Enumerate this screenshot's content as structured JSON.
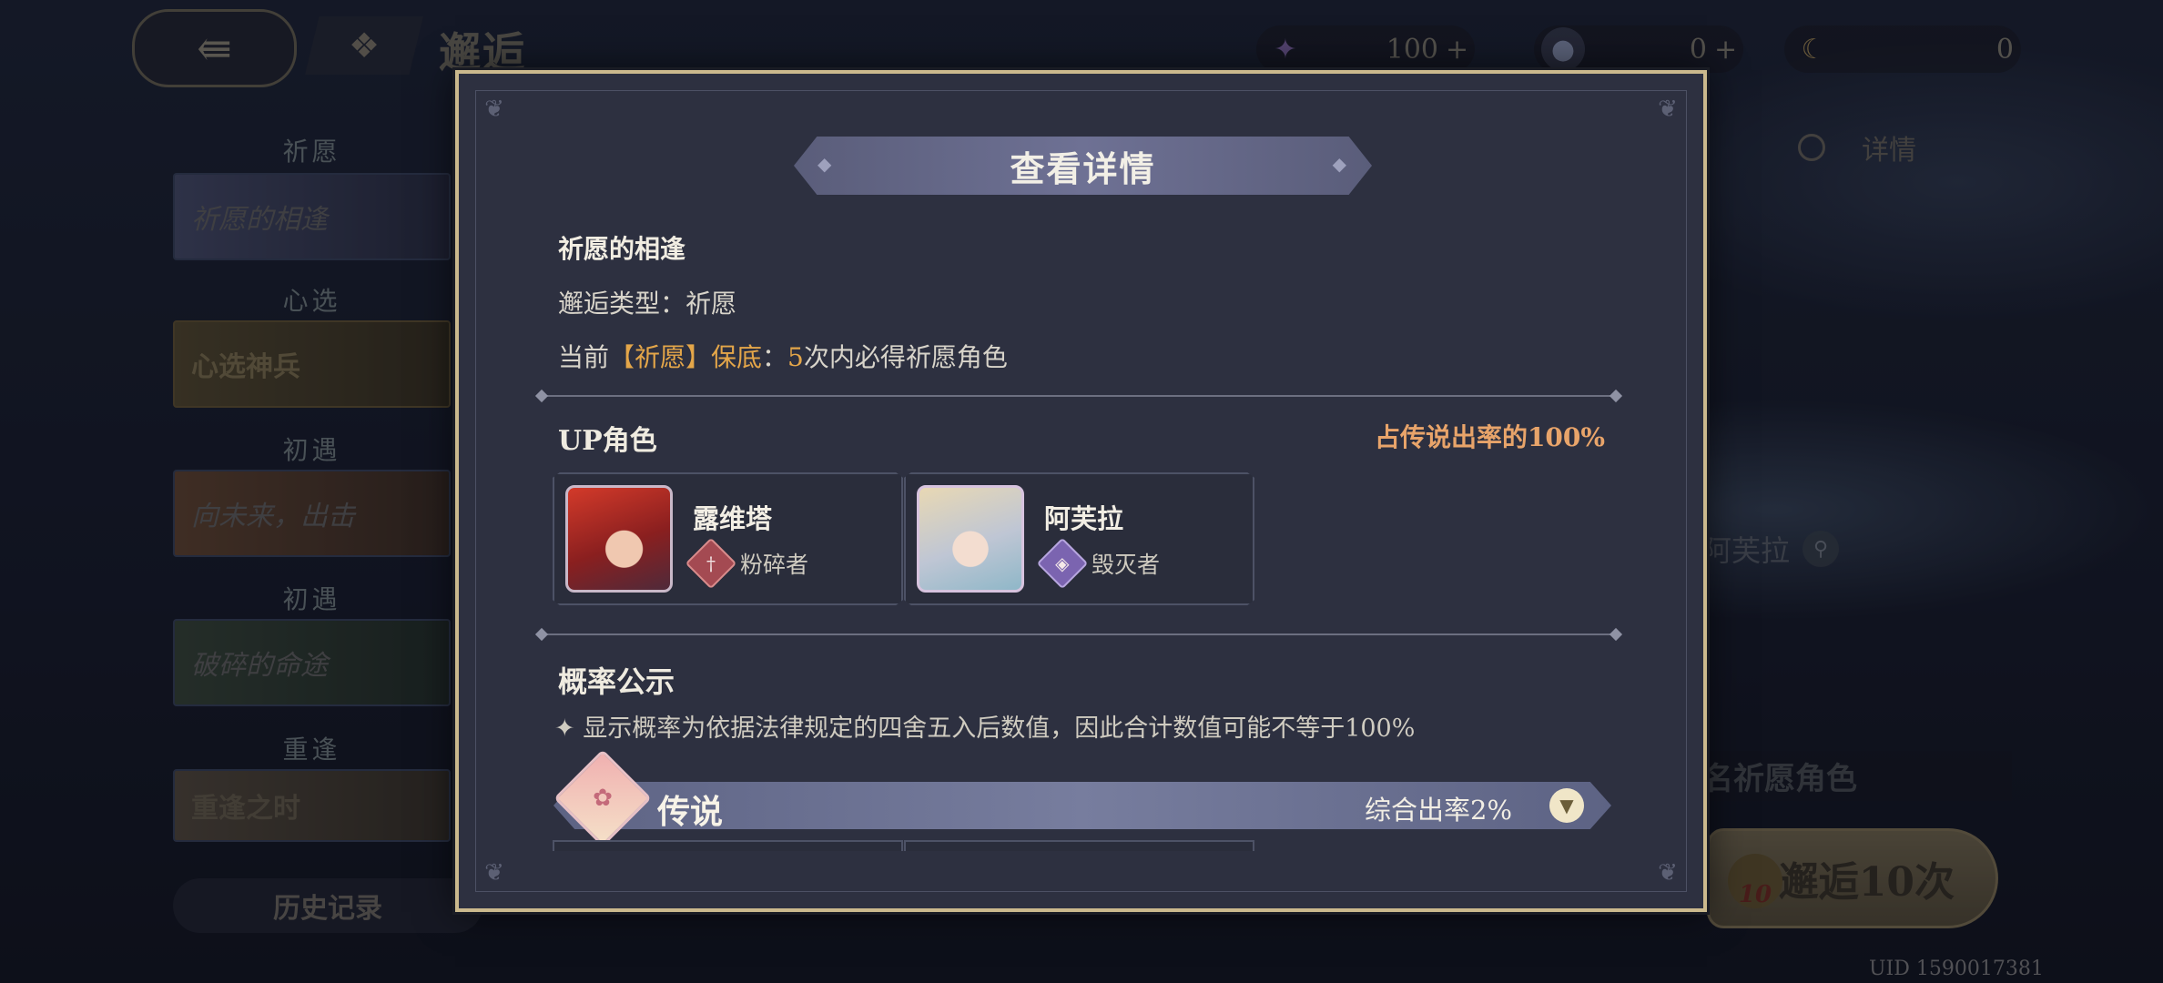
{
  "header": {
    "page_title": "邂逅",
    "back_icon": "back-arrow-icon",
    "menu_icon": "grid-menu-icon",
    "currencies": [
      {
        "icon": "purple-star-icon",
        "value": "100",
        "plus": "+"
      },
      {
        "icon": "orb-icon",
        "value": "0",
        "plus": "+"
      },
      {
        "icon": "moon-token-icon",
        "value": "0"
      }
    ]
  },
  "sidebar": {
    "sections": [
      {
        "category": "祈愿",
        "card": "祈愿的相逢"
      },
      {
        "category": "心选",
        "card": "心选神兵"
      },
      {
        "category": "初遇",
        "card": "向未来，出击"
      },
      {
        "category": "初遇",
        "card": "破碎的命途"
      },
      {
        "category": "重逢",
        "card": "重逢之时"
      }
    ],
    "history": "历史记录"
  },
  "background": {
    "detail_link": "详情",
    "name_tag": "阿芙拉",
    "promo_text": "名祈愿角色",
    "pull_button": "邂逅10次",
    "pull_badge": "10",
    "uid": "UID 1590017381"
  },
  "modal": {
    "title": "查看详情",
    "banner_name": "祈愿的相逢",
    "type_label": "邂逅类型：",
    "type_value": "祈愿",
    "pity_prefix": "当前",
    "pity_highlight": "【祈愿】保底",
    "pity_colon": "：",
    "pity_count": "5",
    "pity_suffix": "次内必得祈愿角色",
    "up_title": "UP角色",
    "up_rate": "占传说出率的100%",
    "characters": [
      {
        "name": "露维塔",
        "role": "粉碎者",
        "role_icon": "crusher-class-icon",
        "role_color": "#a44a52"
      },
      {
        "name": "阿芙拉",
        "role": "毁灭者",
        "role_icon": "destroyer-class-icon",
        "role_color": "#7b64b0"
      }
    ],
    "prob_title": "概率公示",
    "prob_note": "✦ 显示概率为依据法律规定的四舍五入后数值，因此合计数值可能不等于100%",
    "legendary": {
      "label": "传说",
      "rate": "综合出率2%",
      "expand_icon": "chevron-down-icon"
    }
  }
}
